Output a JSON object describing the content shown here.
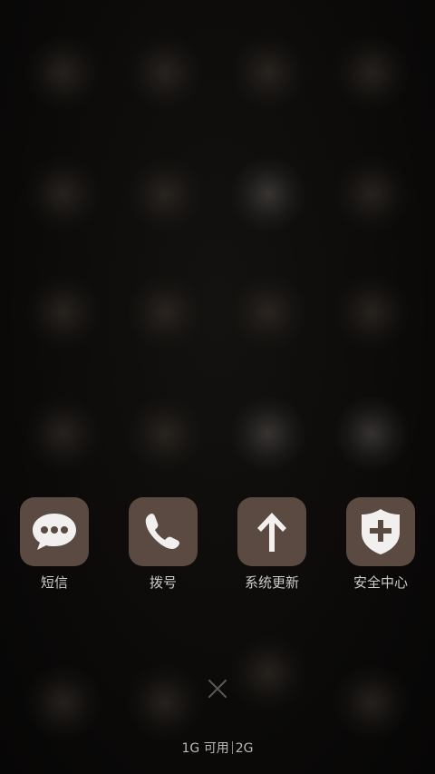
{
  "dock": {
    "items": [
      {
        "label": "短信",
        "icon": "message-bubble-icon"
      },
      {
        "label": "拨号",
        "icon": "phone-icon"
      },
      {
        "label": "系统更新",
        "icon": "arrow-up-icon"
      },
      {
        "label": "安全中心",
        "icon": "shield-plus-icon"
      }
    ]
  },
  "memory": {
    "available": "1G 可用",
    "total": "2G"
  },
  "colors": {
    "tile": "#5a4a41",
    "label": "#cfcac6",
    "background": "#0b0a09"
  }
}
